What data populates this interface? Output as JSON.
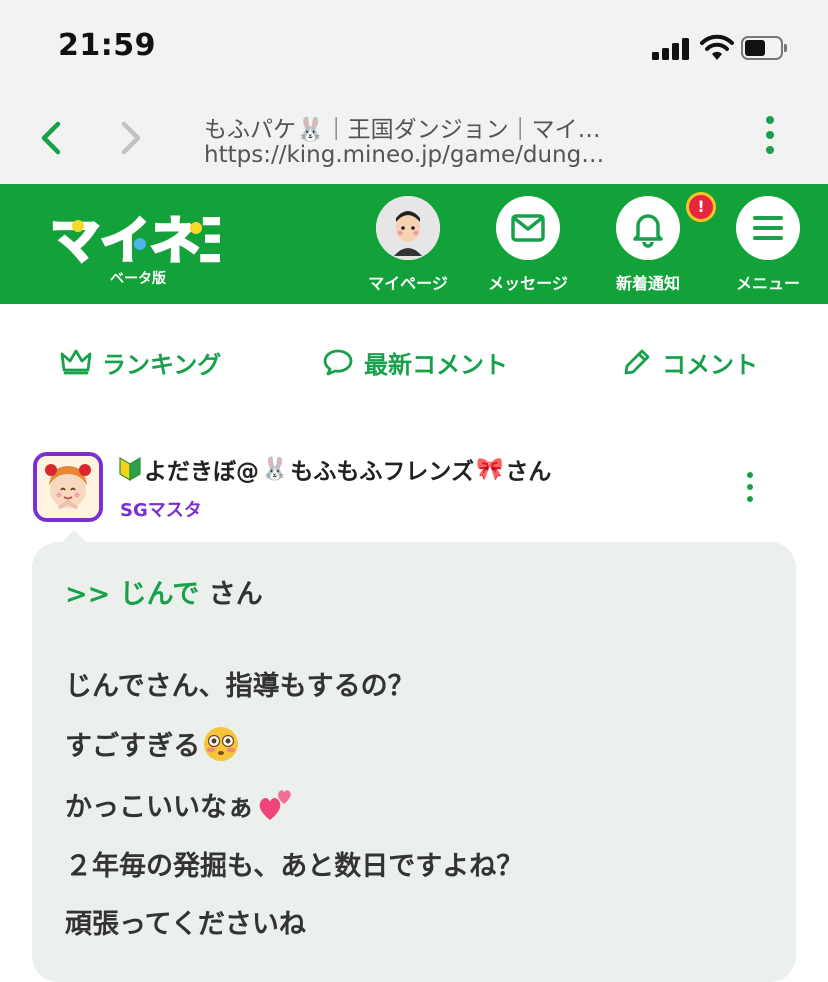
{
  "status_bar": {
    "time": "21:59"
  },
  "browser": {
    "page_title": "もふパケ🐰｜王国ダンジョン｜マイ…",
    "url": "https://king.mineo.jp/game/dung…"
  },
  "header": {
    "logo_text": "マイネ王",
    "beta_label": "ベータ版",
    "nav": {
      "mypage": "マイページ",
      "messages": "メッセージ",
      "notifications": "新着通知",
      "menu": "メニュー"
    },
    "notification_badge": "!",
    "brand_color": "#12a239"
  },
  "tabs": {
    "ranking": "ランキング",
    "latest_comments": "最新コメント",
    "comment": "コメント"
  },
  "comment": {
    "user_prefix_icon": "beginner-mark-icon",
    "user_name_a": "よだきぼ@",
    "user_name_b": "もふもふフレンズ",
    "user_name_c": "さん",
    "rank": "SGマスタ",
    "reply_to": ">> じんで",
    "reply_suffix": " さん",
    "lines": [
      "じんでさん、指導もするの？",
      "すごすぎる",
      "かっこいいなぁ",
      "２年毎の発掘も、あと数日ですよね？",
      "頑張ってくださいね"
    ]
  }
}
